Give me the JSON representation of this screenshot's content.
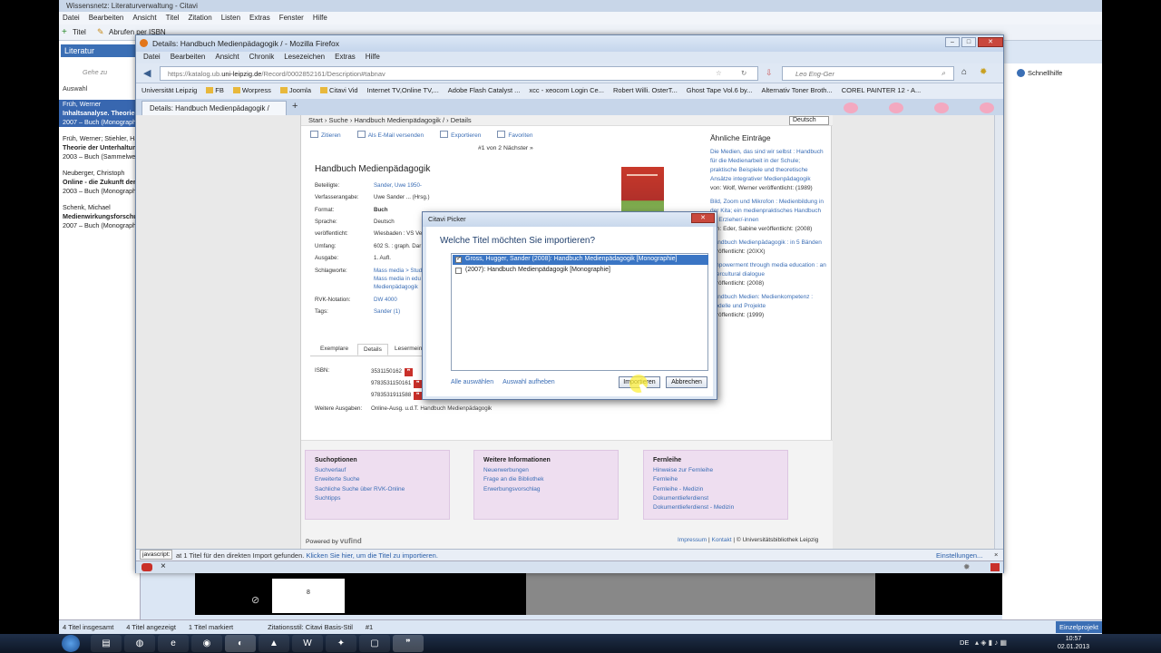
{
  "citavi": {
    "title": "Wissensnetz: Literaturverwaltung - Citavi",
    "menu": [
      "Datei",
      "Bearbeiten",
      "Ansicht",
      "Titel",
      "Zitation",
      "Listen",
      "Extras",
      "Fenster",
      "Hilfe"
    ],
    "toolbar": {
      "new_title": "Titel",
      "isbn": "Abrufen per ISBN"
    },
    "nav_tab": "Literatur",
    "search_placeholder": "Gehe zu",
    "selection_label": "Auswahl",
    "help_link": "Schnellhilfe",
    "list_items": [
      {
        "line1": "Früh, Werner",
        "line2": "Inhaltsanalyse. Theorie u",
        "line3": "2007 – Buch (Monograph",
        "selected": true
      },
      {
        "line1": "Früh, Werner; Stiehler, Ha",
        "line2": "Theorie der Unterhaltun",
        "line3": "2003 – Buch (Sammelwe",
        "selected": false
      },
      {
        "line1": "Neuberger, Christoph",
        "line2": "Online - die Zukunft der",
        "line3": "2003 – Buch (Monograph",
        "selected": false
      },
      {
        "line1": "Schenk, Michael",
        "line2": "Medienwirkungsforschun",
        "line3": "2007 – Buch (Monograph",
        "selected": false
      }
    ],
    "page_number": "8",
    "status": [
      "4 Titel insgesamt",
      "4 Titel angezeigt",
      "1 Titel markiert",
      "Zitationsstil: Citavi Basis-Stil",
      "#1"
    ],
    "project": "Einzelprojekt"
  },
  "firefox": {
    "title": "Details: Handbuch Medienpädagogik / - Mozilla Firefox",
    "menu": [
      "Datei",
      "Bearbeiten",
      "Ansicht",
      "Chronik",
      "Lesezeichen",
      "Extras",
      "Hilfe"
    ],
    "url_prefix": "https://katalog.ub.",
    "url_domain": "uni-leipzig.de",
    "url_suffix": "/Record/0002852161/Description#tabnav",
    "search_placeholder": "Leo Eng-Ger",
    "bookmarks": [
      "Universität Leipzig",
      "FB",
      "Worpress",
      "Joomla",
      "Citavi Vid",
      "Internet TV,Online TV,...",
      "Adobe Flash Catalyst ...",
      "xcc - xeocom Login Ce...",
      "Robert Willi. OsterT...",
      "Ghost Tape Vol.6 by...",
      "Alternativ Toner Broth...",
      "COREL PAINTER 12 - A..."
    ],
    "tab_label": "Details: Handbuch Medienpädagogik /",
    "new_tab": "+",
    "notification_text": "at 1 Titel für den direkten Import gefunden.",
    "notification_link": "Klicken Sie hier, um die Titel zu importieren.",
    "settings_link": "Einstellungen...",
    "js_label": "javascript:"
  },
  "catalog": {
    "breadcrumb": "Start › Suche › Handbuch Medienpädagogik / › Details",
    "language": "Deutsch",
    "actions": [
      "Zitieren",
      "Als E-Mail versenden",
      "Exportieren",
      "Favoriten"
    ],
    "pager": "#1 von 2 Nächster »",
    "title": "Handbuch Medienpädagogik",
    "fields": [
      {
        "label": "Beteiligte:",
        "value": "Sander, Uwe 1950-",
        "link": true
      },
      {
        "label": "Verfasserangabe:",
        "value": "Uwe Sander ... (Hrsg.)",
        "link": false
      },
      {
        "label": "Format:",
        "value": "Buch",
        "link": false
      },
      {
        "label": "Sprache:",
        "value": "Deutsch",
        "link": false
      },
      {
        "label": "veröffentlicht:",
        "value": "Wiesbaden : VS Ve",
        "link": false
      },
      {
        "label": "Umfang:",
        "value": "602 S. : graph. Dar",
        "link": false
      },
      {
        "label": "Ausgabe:",
        "value": "1. Aufl.",
        "link": false
      },
      {
        "label": "Schlagworte:",
        "value": "Mass media > Stud",
        "link": true
      },
      {
        "label": "RVK-Notation:",
        "value": "DW 4000",
        "link": true
      },
      {
        "label": "Tags:",
        "value": "Sander (1)",
        "link": true
      }
    ],
    "keywords_extra": [
      "Mass media in edu",
      "Medienpädagogik"
    ],
    "tabs": [
      "Exemplare",
      "Details",
      "Lesermeinun"
    ],
    "isbn_label": "ISBN:",
    "isbns": [
      "3531150162",
      "9783531150161",
      "9783531911588"
    ],
    "other_editions_label": "Weitere Ausgaben:",
    "other_editions": "Online-Ausg. u.d.T. Handbuch Medienpädagogik",
    "similar_title": "Ähnliche Einträge",
    "similar": [
      {
        "link": "Die Medien, das sind wir selbst : Handbuch für die Medienarbeit in der Schule; praktische Beispiele und theoretische Ansätze integrativer Medienpädagogik",
        "meta": "von: Wolf, Werner veröffentlicht: (1989)"
      },
      {
        "link": "Bild, Zoom und Mikrofon : Medienbildung in der Kita; ein medienpraktisches Handbuch für Erzieher/-innen",
        "meta": "von: Eder, Sabine veröffentlicht: (2008)"
      },
      {
        "link": "Handbuch Medienpädagogik : in 5 Bänden",
        "meta": "veröffentlicht: (20XX)"
      },
      {
        "link": "Empowerment through media education : an intercultural dialogue",
        "meta": "veröffentlicht: (2008)"
      },
      {
        "link": "Handbuch Medien: Medienkompetenz : Modelle und Projekte",
        "meta": "veröffentlicht: (1999)"
      }
    ],
    "footer_boxes": [
      {
        "title": "Suchoptionen",
        "links": [
          "Suchverlauf",
          "Erweiterte Suche",
          "Sachliche Suche über RVK-Online",
          "Suchtipps"
        ]
      },
      {
        "title": "Weitere Informationen",
        "links": [
          "Neuerwerbungen",
          "Frage an die Bibliothek",
          "Erwerbungsvorschlag"
        ]
      },
      {
        "title": "Fernleihe",
        "links": [
          "Hinweise zur Fernleihe",
          "Fernleihe",
          "Fernleihe - Medizin",
          "Dokumentlieferdienst",
          "Dokumentlieferdienst - Medizin"
        ]
      }
    ],
    "powered_by": "Powered by",
    "powered_logo": "vufind",
    "footer_links": [
      "Impressum",
      "Kontakt"
    ],
    "copyright": "© Universitätsbibliothek Leipzig"
  },
  "dialog": {
    "title": "Citavi Picker",
    "question": "Welche Titel möchten Sie importieren?",
    "items": [
      {
        "text": "Gross, Hugger, Sander (2008): Handbuch Medienpädagogik [Monographie]",
        "checked": true,
        "selected": true
      },
      {
        "text": "(2007): Handbuch Medienpädagogik [Monographie]",
        "checked": false,
        "selected": false
      }
    ],
    "select_all": "Alle auswählen",
    "deselect": "Auswahl aufheben",
    "import_button": "Importieren",
    "cancel_button": "Abbrechen"
  },
  "taskbar": {
    "language": "DE",
    "time": "10:57",
    "date": "02.01.2013"
  }
}
